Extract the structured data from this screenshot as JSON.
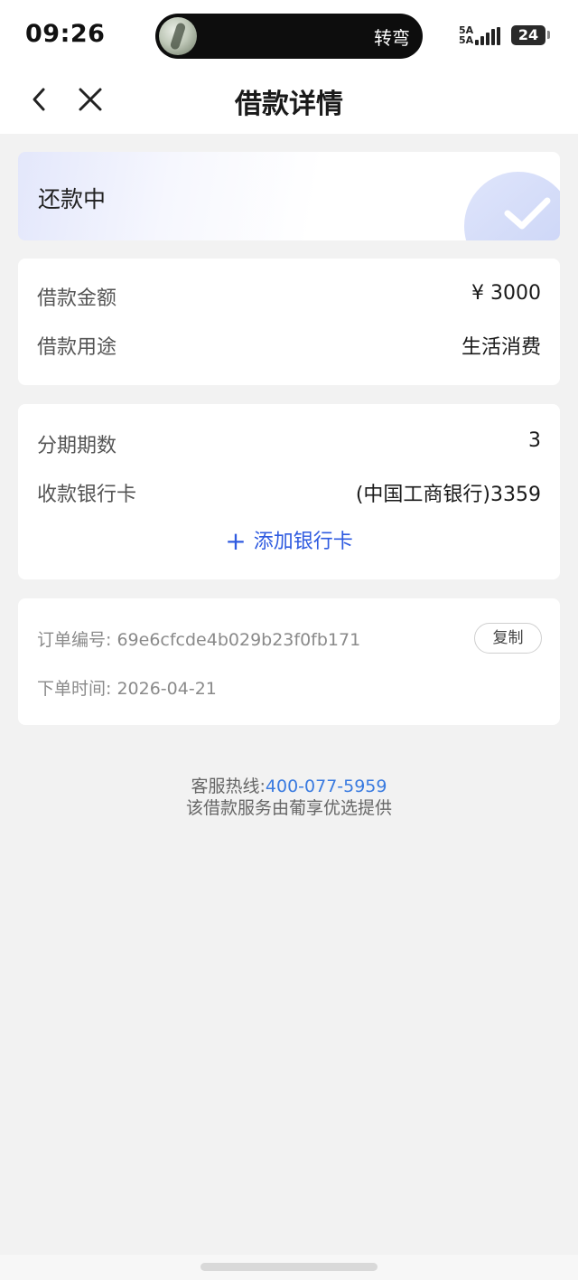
{
  "status_bar": {
    "time": "09:26",
    "island_text": "转弯",
    "signal_label_top": "5A",
    "signal_label_bottom": "5A",
    "battery": "24"
  },
  "nav": {
    "title": "借款详情",
    "back_icon": "chevron-left-icon",
    "close_icon": "close-icon"
  },
  "loan_status": {
    "text": "还款中",
    "icon": "check-icon"
  },
  "loan_info": {
    "amount_label": "借款金额",
    "amount_value": "¥ 3000",
    "purpose_label": "借款用途",
    "purpose_value": "生活消费"
  },
  "installment": {
    "periods_label": "分期期数",
    "periods_value": "3",
    "bank_label": "收款银行卡",
    "bank_value": "(中国工商银行)3359",
    "add_bank_label": "添加银行卡",
    "add_bank_icon": "plus-icon"
  },
  "order": {
    "number_label": "订单编号:",
    "number_value": "69e6cfcde4b029b23f0fb171",
    "copy_label": "复制",
    "time_label": "下单时间:",
    "time_value": "2026-04-21"
  },
  "footer": {
    "hotline_label": "客服热线:",
    "hotline_number": "400-077-5959",
    "provider_text": "该借款服务由葡享优选提供"
  },
  "colors": {
    "accent": "#2f5be0",
    "hotline": "#3a7be0",
    "background": "#f2f2f2"
  }
}
